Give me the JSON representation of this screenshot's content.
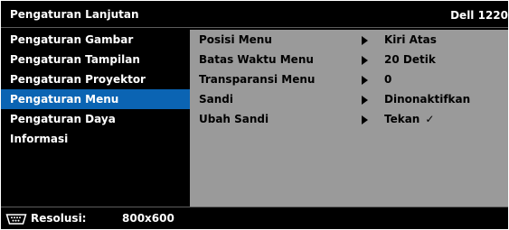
{
  "header": {
    "title": "Pengaturan Lanjutan",
    "model": "Dell 1220"
  },
  "sidebar": {
    "items": [
      {
        "label": "Pengaturan Gambar"
      },
      {
        "label": "Pengaturan Tampilan"
      },
      {
        "label": "Pengaturan Proyektor"
      },
      {
        "label": "Pengaturan Menu"
      },
      {
        "label": "Pengaturan Daya"
      },
      {
        "label": "Informasi"
      }
    ],
    "selected": "Pengaturan Menu"
  },
  "settings": {
    "rows": [
      {
        "label": "Posisi Menu",
        "value": "Kiri Atas"
      },
      {
        "label": "Batas Waktu Menu",
        "value": "20 Detik"
      },
      {
        "label": "Transparansi Menu",
        "value": "0"
      },
      {
        "label": "Sandi",
        "value": "Dinonaktifkan"
      },
      {
        "label": "Ubah Sandi",
        "value": "Tekan",
        "check": "✓"
      }
    ]
  },
  "footer": {
    "icon": "vga-connector-icon",
    "label": "Resolusi:",
    "value": "800x600"
  },
  "colors": {
    "background": "#000000",
    "highlight": "#0b64b3",
    "panel": "#9a9a9a",
    "text_light": "#ffffff",
    "text_dark": "#000000"
  }
}
